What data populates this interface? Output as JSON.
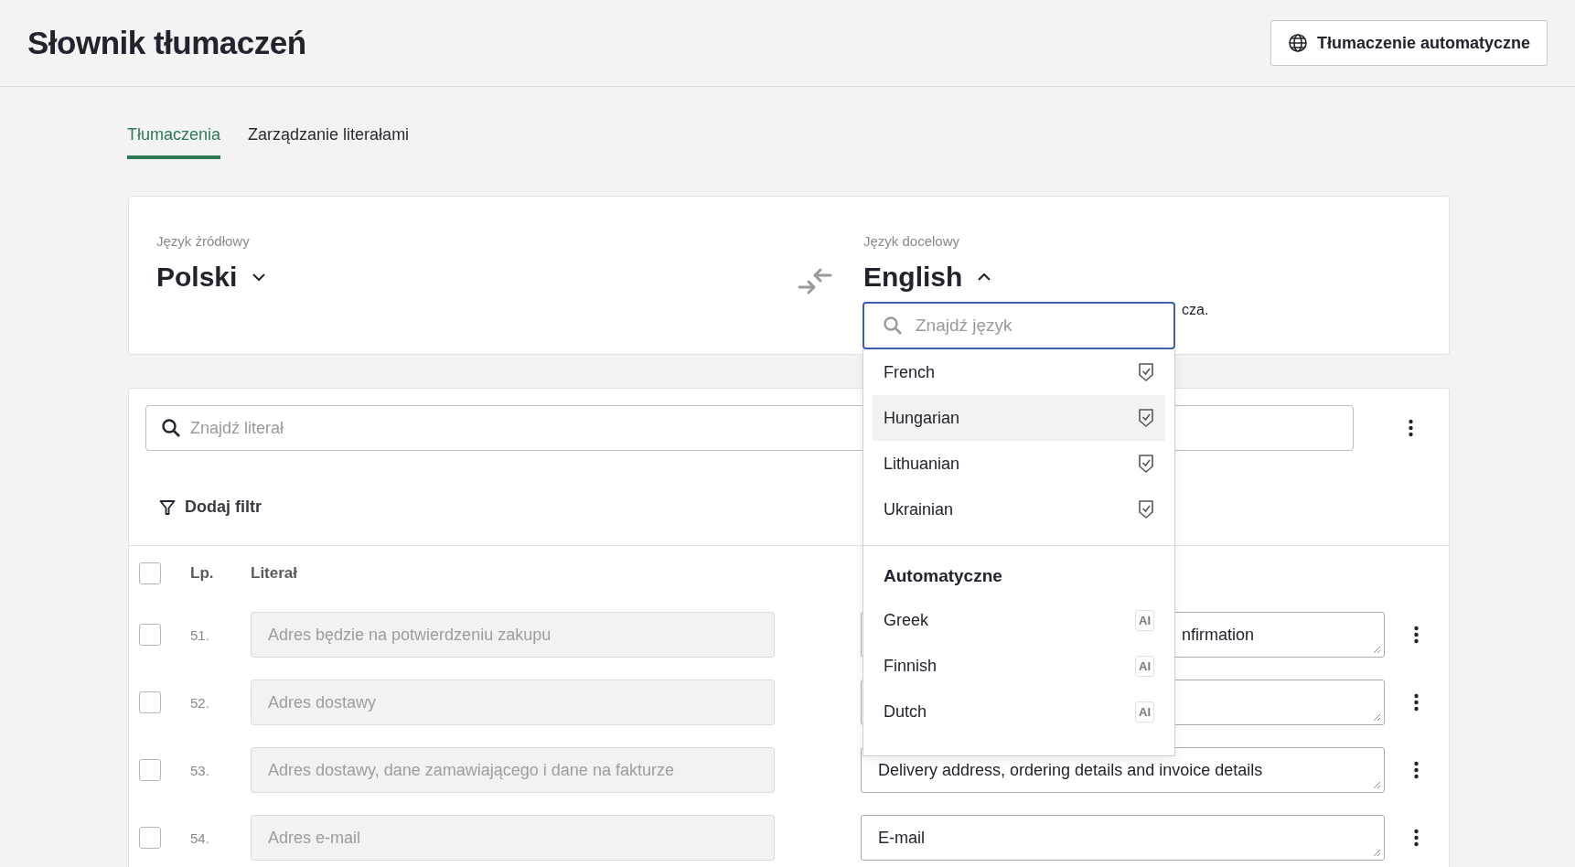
{
  "header": {
    "title": "Słownik tłumaczeń",
    "auto_translate_button": "Tłumaczenie automatyczne"
  },
  "tabs": [
    {
      "label": "Tłumaczenia",
      "selected": true
    },
    {
      "label": "Zarządzanie literałami",
      "selected": false
    }
  ],
  "languages": {
    "source": {
      "label": "Język źródłowy",
      "value": "Polski",
      "expanded": false
    },
    "target": {
      "label": "Język docelowy",
      "value": "English",
      "expanded": true
    },
    "hint": "cza."
  },
  "language_dropdown": {
    "search": {
      "placeholder": "Znajdź język"
    },
    "groups": [
      {
        "items": [
          {
            "name": "French",
            "kind": "verified",
            "highlighted": false
          },
          {
            "name": "Hungarian",
            "kind": "verified",
            "highlighted": true
          },
          {
            "name": "Lithuanian",
            "kind": "verified",
            "highlighted": false
          },
          {
            "name": "Ukrainian",
            "kind": "verified",
            "highlighted": false
          }
        ]
      },
      {
        "heading": "Automatyczne",
        "items": [
          {
            "name": "Greek",
            "kind": "ai",
            "badge": "AI",
            "highlighted": false
          },
          {
            "name": "Finnish",
            "kind": "ai",
            "badge": "AI",
            "highlighted": false
          },
          {
            "name": "Dutch",
            "kind": "ai",
            "badge": "AI",
            "highlighted": false
          }
        ]
      }
    ]
  },
  "literals": {
    "search": {
      "placeholder": "Znajdź literał"
    },
    "filter_button": "Dodaj filtr",
    "columns": [
      "Lp.",
      "Literał"
    ],
    "all_checked": false,
    "rows": [
      {
        "number": "51.",
        "source": "Adres będzie na potwierdzeniu zakupu",
        "target": "nfirmation",
        "covered": true,
        "checked": false
      },
      {
        "number": "52.",
        "source": "Adres dostawy",
        "checked": false
      },
      {
        "number": "53.",
        "source": "Adres dostawy, dane zamawiającego i dane na fakturze",
        "target": "Delivery address, ordering details and invoice details",
        "covered": false,
        "checked": false
      },
      {
        "number": "54.",
        "source": "Adres e-mail",
        "target": "E-mail",
        "covered": false,
        "checked": false
      }
    ]
  }
}
